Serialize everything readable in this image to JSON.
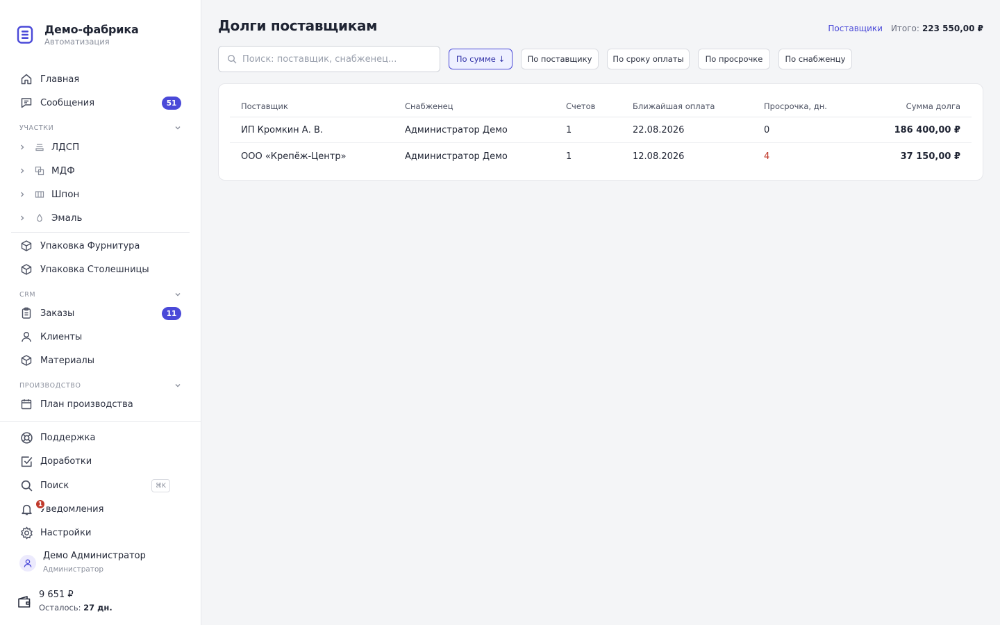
{
  "brand": {
    "title": "Демо-фабрика",
    "subtitle": "Автоматизация"
  },
  "nav": {
    "home": "Главная",
    "messages": "Сообщения",
    "messages_badge": "51",
    "participants_section": "Участки",
    "participants": [
      {
        "label": "ЛДСП",
        "icon": "stack-icon"
      },
      {
        "label": "МДФ",
        "icon": "layers-icon"
      },
      {
        "label": "Шпон",
        "icon": "veneer-icon"
      },
      {
        "label": "Эмаль",
        "icon": "drop-icon"
      }
    ],
    "packaging": [
      "Упаковка Фурнитура",
      "Упаковка Столешницы"
    ],
    "crm_section": "CRM",
    "orders": "Заказы",
    "orders_badge": "11",
    "clients": "Клиенты",
    "materials": "Материалы",
    "production_section": "Производство",
    "production_plan": "План производства",
    "support": "Поддержка",
    "improvements": "Доработки",
    "search": "Поиск",
    "search_shortcut": "⌘K",
    "notifications": "Уведомления",
    "notifications_badge": "1",
    "settings": "Настройки"
  },
  "user": {
    "name": "Демо Администратор",
    "role": "Администратор"
  },
  "wallet": {
    "amount": "9 651 ₽",
    "left_label": "Осталось:",
    "left_value": "27 дн."
  },
  "page": {
    "title": "Долги поставщикам",
    "link": "Поставщики",
    "total_label": "Итого:",
    "total_value": "223 550,00 ₽"
  },
  "search": {
    "placeholder": "Поиск: поставщик, снабженец..."
  },
  "sort": {
    "selected": "По сумме ↓",
    "options": [
      "По сумме ↓",
      "По поставщику",
      "По сроку оплаты",
      "По просрочке",
      "По снабженцу"
    ]
  },
  "table": {
    "columns": [
      "Поставщик",
      "Снабженец",
      "Счетов",
      "Ближайшая оплата",
      "Просрочка, дн.",
      "Сумма долга"
    ],
    "rows": [
      {
        "supplier": "ИП Кромкин А. В.",
        "buyer": "Администратор Демо",
        "invoices": "1",
        "next_payment": "22.08.2026",
        "overdue_days": "0",
        "amount": "186 400,00 ₽"
      },
      {
        "supplier": "ООО «Крепёж-Центр»",
        "buyer": "Администратор Демо",
        "invoices": "1",
        "next_payment": "12.08.2026",
        "overdue_days": "4",
        "amount": "37 150,00 ₽"
      }
    ]
  },
  "colors": {
    "accent": "#4a49d8",
    "danger": "#c0392b",
    "background": "#f4f5f7"
  }
}
